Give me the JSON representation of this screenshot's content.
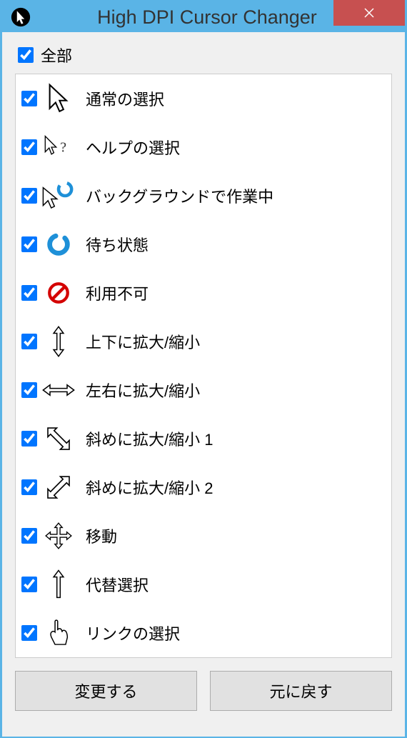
{
  "title": "High DPI Cursor Changer",
  "all_label": "全部",
  "cursors": [
    {
      "id": "normal",
      "label": "通常の選択",
      "checked": true
    },
    {
      "id": "help",
      "label": "ヘルプの選択",
      "checked": true
    },
    {
      "id": "working",
      "label": "バックグラウンドで作業中",
      "checked": true
    },
    {
      "id": "busy",
      "label": "待ち状態",
      "checked": true
    },
    {
      "id": "unavailable",
      "label": "利用不可",
      "checked": true
    },
    {
      "id": "resize-ns",
      "label": "上下に拡大/縮小",
      "checked": true
    },
    {
      "id": "resize-ew",
      "label": "左右に拡大/縮小",
      "checked": true
    },
    {
      "id": "resize-nwse",
      "label": "斜めに拡大/縮小 1",
      "checked": true
    },
    {
      "id": "resize-nesw",
      "label": "斜めに拡大/縮小 2",
      "checked": true
    },
    {
      "id": "move",
      "label": "移動",
      "checked": true
    },
    {
      "id": "alternate",
      "label": "代替選択",
      "checked": true
    },
    {
      "id": "link",
      "label": "リンクの選択",
      "checked": true
    }
  ],
  "buttons": {
    "apply": "変更する",
    "revert": "元に戻す"
  }
}
